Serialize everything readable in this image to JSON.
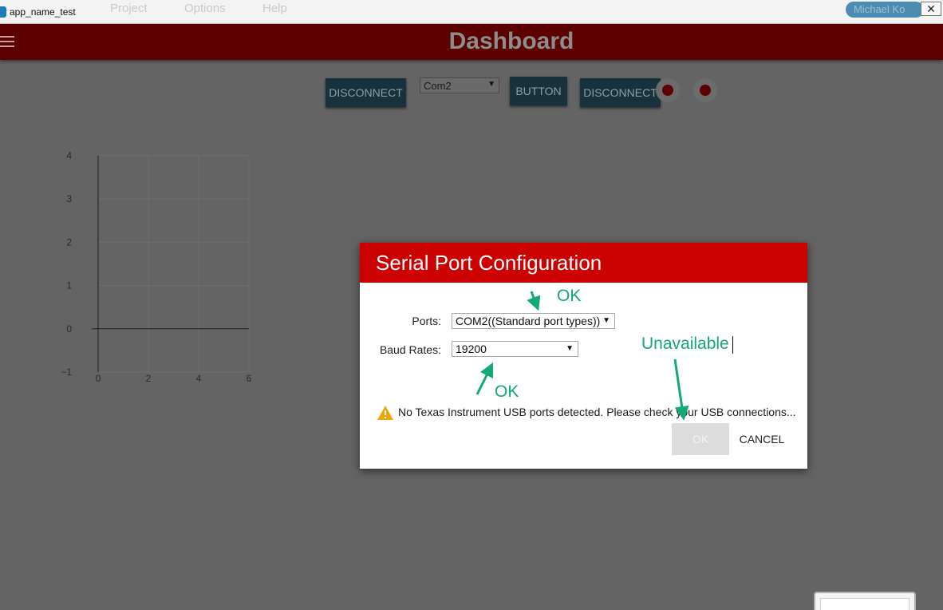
{
  "window": {
    "title": "app_name_test",
    "menu": [
      "Project",
      "Options",
      "Help"
    ],
    "user": "Michael Ko",
    "close_glyph": "✕"
  },
  "header": {
    "title": "Dashboard"
  },
  "toolbar": {
    "disconnect_label": "DISCONNECT",
    "port_select": "Com2",
    "button_label": "BUTTON",
    "disconnect2_label": "DISCONNECT"
  },
  "colors": {
    "header_bg": "#5c0000",
    "dialog_header": "#cc0000",
    "annotation": "#12a878",
    "toolbar_button": "#17323c"
  },
  "chart_data": {
    "type": "line",
    "series": [],
    "x_ticks": [
      "0",
      "2",
      "4",
      "6"
    ],
    "y_ticks": [
      "4",
      "3",
      "2",
      "1",
      "0",
      "−1"
    ],
    "xlim": [
      0,
      6
    ],
    "ylim": [
      -1,
      4
    ],
    "grid": true
  },
  "dialog": {
    "title": "Serial Port Configuration",
    "ports_label": "Ports:",
    "ports_value": "COM2((Standard port types))",
    "baud_label": "Baud Rates:",
    "baud_value": "19200",
    "warning": "No Texas Instrument USB ports detected. Please check your USB connections...",
    "ok_label": "OK",
    "cancel_label": "CANCEL"
  },
  "annotations": {
    "ports_note": "OK",
    "baud_note": "OK",
    "ok_note": "Unavailable"
  }
}
